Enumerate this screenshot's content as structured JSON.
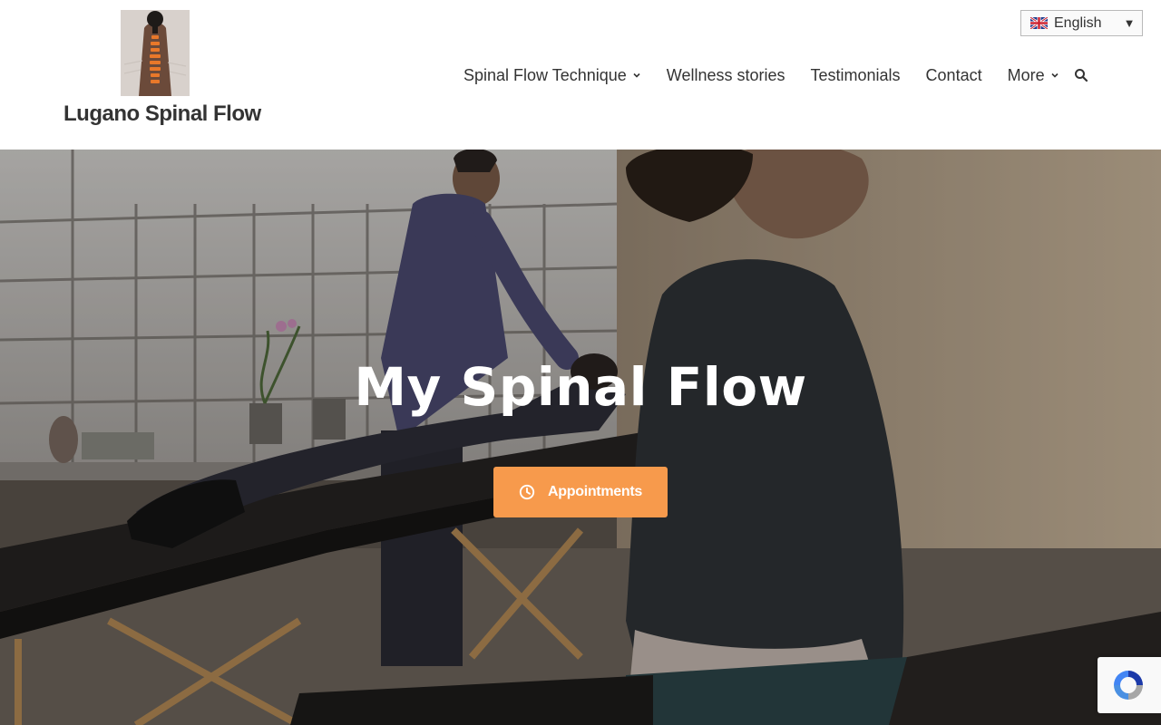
{
  "site": {
    "title": "Lugano Spinal Flow"
  },
  "language_selector": {
    "selected": "English",
    "flag_icon": "uk-flag-icon",
    "caret_icon": "caret-down-icon"
  },
  "nav": {
    "items": [
      {
        "label": "Spinal Flow Technique",
        "has_dropdown": true
      },
      {
        "label": "Wellness stories",
        "has_dropdown": false
      },
      {
        "label": "Testimonials",
        "has_dropdown": false
      },
      {
        "label": "Contact",
        "has_dropdown": false
      },
      {
        "label": "More",
        "has_dropdown": true
      }
    ],
    "search_icon": "search-icon"
  },
  "hero": {
    "title": "My Spinal Flow",
    "button_label": "Appointments",
    "button_icon": "clock-icon"
  },
  "colors": {
    "accent": "#f79a4c",
    "text": "#333333"
  }
}
